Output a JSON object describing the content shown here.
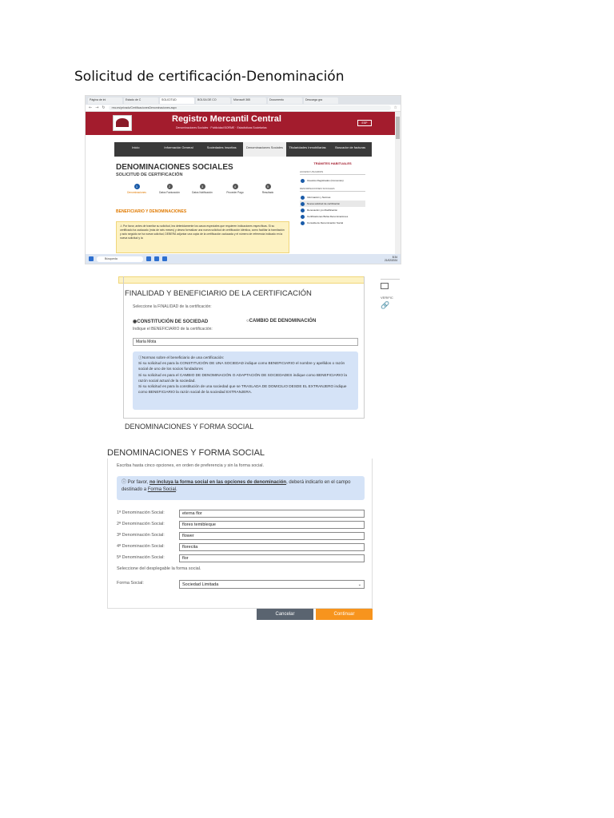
{
  "doc": {
    "title": "Solicitud de certificación-Denominación"
  },
  "shot1": {
    "tabs": [
      "Página de ini",
      "Estado de C",
      "SOLICITUD",
      "BOLSA DE CO",
      "Microsoft 365",
      "Documento",
      "Descarga gra"
    ],
    "address": "rmc.es/privado/CertificacionesDenominaciones.aspx",
    "header_title": "Registro Mercantil Central",
    "header_sub": "Denominaciones Sociales · Publicidad BORME · Estadísticas Societarias",
    "lang": "ESP",
    "nav": [
      "Inicio",
      "Información General",
      "Sociedades Inscritas",
      "Denominaciones Sociales",
      "Titularidades Inmobiliarias",
      "Buscador de facturas"
    ],
    "page_title": "DENOMINACIONES SOCIALES",
    "page_sub": "SOLICITUD DE CERTIFICACIÓN",
    "steps": [
      {
        "num": "1",
        "label": "Denominaciones"
      },
      {
        "num": "2",
        "label": "Datos Facturación"
      },
      {
        "num": "3",
        "label": "Datos Notificación"
      },
      {
        "num": "4",
        "label": "Proceder Pago"
      },
      {
        "num": "5",
        "label": "Resultado"
      }
    ],
    "section": "BENEFICIARIO Y DENOMINACIONES",
    "warning": "⚠ Por favor, antes de tramitar su solicitud, lea detenidamente los casos especiales que requieren indicaciones específicas. Si su certificado ha caducado (más de seis meses) y desea formalizar una nueva solicitud de certificación idéntica, como facilitar la tramitación y acto seguido se ha nueva solicitud, DEBERÁ adjuntar una copia de la certificación caducada y el número de referencia indicado en la nueva solicitud y la",
    "side_title": "TRÁMITES HABITUALES",
    "side_sec1": "ACCESO USUARIOS",
    "side_item1": "Usuarios Registrados (Convenios)",
    "side_sec2": "DENOMINACIONES SOCIALES",
    "side_items": [
      "Información y Normas",
      "Nueva solicitud de certificación",
      "Renovación y/o Modificación",
      "Certificaciones Bolsa Denominaciones",
      "Consulta de Denominación Social"
    ],
    "taskbar_search": "Búsqueda",
    "taskbar_time": "8:34",
    "taskbar_date": "21/02/2024"
  },
  "shot2": {
    "top_strip": "",
    "heading": "FINALIDAD Y BENEFICIARIO DE LA CERTIFICACIÓN",
    "finalidad_prompt": "Seleccione la FINALIDAD de la certificación:",
    "radio1": "◉CONSTITUCIÓN DE SOCIEDAD",
    "radio2": "○CAMBIO DE DENOMINACIÓN",
    "benef_prompt": "Indique el BENEFICIARIO de la certificación:",
    "benef_value": "María Mota",
    "info_l1": "ⓘNormas sobre el beneficiario de una certificación:",
    "info_l2": "Si su solicitud es para la CONSTITUCIÓN DE UNA SOCIEDAD indique como BENEFICIARIO el nombre y apellidos o razón social de uno de los socios fundadores",
    "info_l3": "Si su solicitud es para el CAMBIO DE DENOMINACIÓN O ADAPTACIÓN DE SOCIEDADES indique como BENEFICIARIO la razón social actual de la sociedad.",
    "info_l4": "Si su solicitud es para la constitución de una sociedad que se TRASLADA DE DOMICILIO DESDE EL EXTRANJERO indique como BENEFICIARIO la razón social de la sociedad EXTRANJERA.",
    "footer": "DENOMINACIONES Y FORMA SOCIAL",
    "side_label": "VERIFIC"
  },
  "shot3": {
    "heading": "DENOMINACIONES Y FORMA SOCIAL",
    "prompt": "Escriba hasta cinco opciones, en orden de preferencia y sin la forma social.",
    "info_prefix": "ⓘ Por favor, ",
    "info_bold": "no incluya la forma social en las opciones de denominación",
    "info_mid": ", deberá indicarlo en el campo destinado a ",
    "info_link": "Forma Social",
    "info_end": ".",
    "denominaciones": [
      {
        "label": "1ª Denominación Social:",
        "value": "eterna flor"
      },
      {
        "label": "2ª Denominación Social:",
        "value": "flores temibleque"
      },
      {
        "label": "3ª Denominación Social:",
        "value": "flower"
      },
      {
        "label": "4ª Denominación Social:",
        "value": "florecita"
      },
      {
        "label": "5ª Denominación Social:",
        "value": "flor"
      }
    ],
    "select_prompt": "Seleccione del desplegable la forma social.",
    "forma_label": "Forma Social:",
    "forma_value": "Sociedad Limitada",
    "cancel": "Cancelar",
    "continue": "Continuar"
  }
}
